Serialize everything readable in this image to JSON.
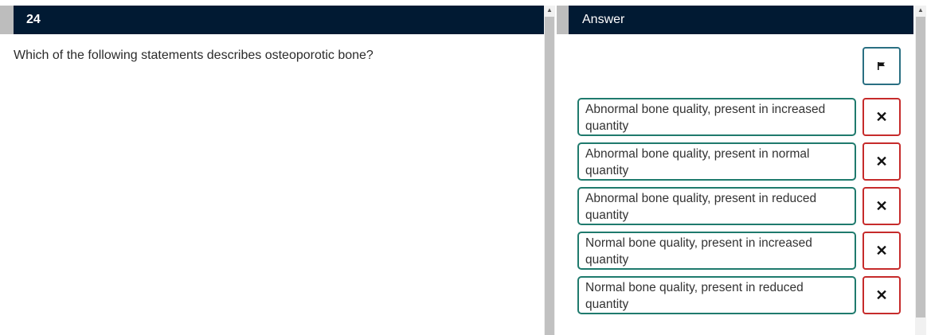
{
  "question": {
    "number": "24",
    "text": "Which of the following statements describes osteoporotic bone?"
  },
  "answer": {
    "header": "Answer",
    "options": [
      {
        "label": "Abnormal bone quality, present in increased quantity"
      },
      {
        "label": "Abnormal bone quality, present in normal quantity"
      },
      {
        "label": "Abnormal bone quality, present in reduced quantity"
      },
      {
        "label": "Normal bone quality, present in increased quantity"
      },
      {
        "label": "Normal bone quality, present in reduced quantity"
      }
    ],
    "remove_glyph": "✕"
  },
  "colors": {
    "header_bg": "#011a33",
    "option_border": "#1f7a6d",
    "remove_border": "#c62b2b",
    "flag_border": "#2a6f82"
  },
  "icons": [
    "flag-icon",
    "close-icon",
    "scroll-up-arrow-icon"
  ]
}
